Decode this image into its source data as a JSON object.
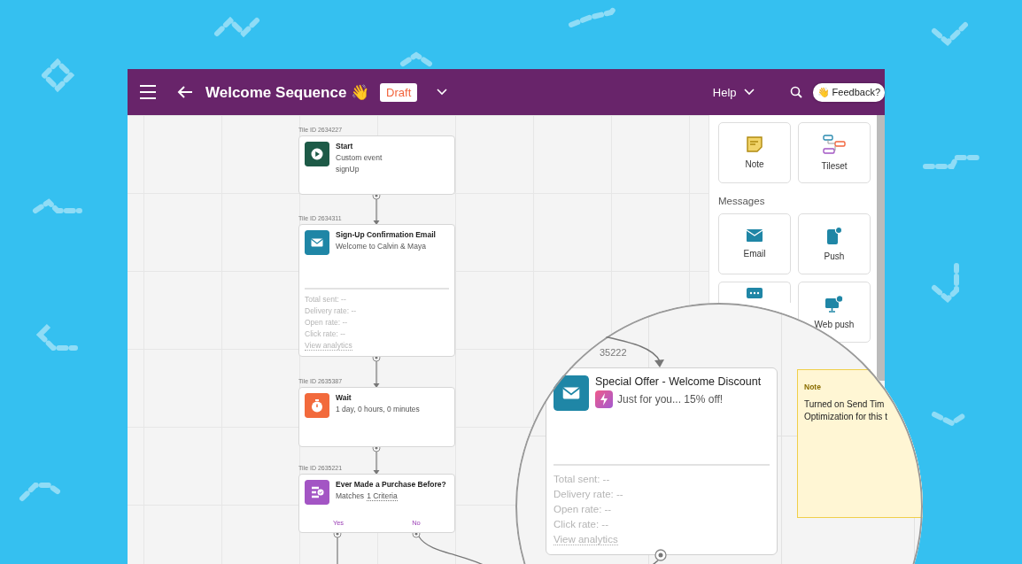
{
  "header": {
    "title": "Welcome Sequence 👋",
    "status": "Draft",
    "help": "Help",
    "feedback": "👋 Feedback?"
  },
  "tiles": [
    {
      "kind": "start",
      "tile_id": "Tile ID 2634227",
      "title": "Start",
      "lines": [
        "Custom event",
        "signUp"
      ]
    },
    {
      "kind": "message",
      "tile_id": "Tile ID 2634311",
      "title": "Sign-Up Confirmation Email",
      "lines": [
        "Welcome to Calvin & Maya"
      ],
      "stats": [
        "Total sent:  --",
        "Delivery rate:  --",
        "Open rate:  --",
        "Click rate:  --"
      ],
      "link": "View analytics"
    },
    {
      "kind": "delay",
      "tile_id": "Tile ID 2635387",
      "title": "Wait",
      "lines": [
        "1 day, 0 hours, 0 minutes"
      ]
    },
    {
      "kind": "decision",
      "tile_id": "Tile ID 2635221",
      "title": "Ever Made a Purchase Before?",
      "criteria_prefix": "Matches",
      "criteria_link": "1 Criteria",
      "branches": [
        "Yes",
        "No"
      ]
    }
  ],
  "panel": {
    "top_items": [
      {
        "kind": "note",
        "label": "Note"
      },
      {
        "kind": "tileset",
        "label": "Tileset"
      }
    ],
    "section": "Messages",
    "message_items": [
      {
        "kind": "email",
        "label": "Email"
      },
      {
        "kind": "push",
        "label": "Push"
      },
      {
        "kind": "sms"
      },
      {
        "kind": "web_push",
        "label": "Web push"
      }
    ]
  },
  "magnifier": {
    "tile_id": "35222",
    "tile": {
      "kind": "message",
      "title": "Special Offer - Welcome Discount",
      "subtitle": "Just for you... 15% off!",
      "stats": [
        "Total sent:  --",
        "Delivery rate:  --",
        "Open rate:  --",
        "Click rate:  --"
      ],
      "link": "View analytics"
    },
    "note": {
      "title": "Note",
      "lines": [
        "Turned on Send Tim",
        "Optimization for this t"
      ]
    }
  }
}
